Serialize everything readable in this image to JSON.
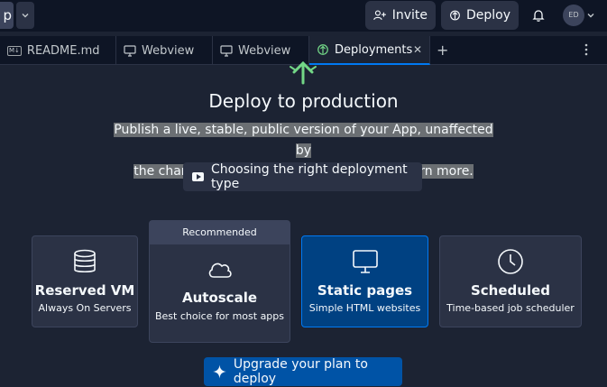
{
  "topbar": {
    "app_initial": "p",
    "invite_label": "Invite",
    "deploy_label": "Deploy",
    "avatar_initials": "ED"
  },
  "tabs": [
    {
      "label": "README.md",
      "icon": "markdown-icon",
      "badge": "M↓",
      "active": false
    },
    {
      "label": "Webview",
      "icon": "monitor-icon",
      "active": false
    },
    {
      "label": "Webview",
      "icon": "monitor-icon",
      "active": false
    },
    {
      "label": "Deployments",
      "icon": "deploy-icon",
      "active": true
    }
  ],
  "main": {
    "title": "Deploy to production",
    "description_line1": "Publish a live, stable, public version of your App, unaffected by",
    "description_line2": "the changes you make in the workspace. Learn more.",
    "guide_label": "Choosing the right deployment type",
    "upgrade_label": "Upgrade your plan to deploy"
  },
  "deployment_types": [
    {
      "name": "Reserved VM",
      "subtitle": "Always On Servers",
      "icon": "database-icon",
      "selected": false
    },
    {
      "name": "Autoscale",
      "subtitle": "Best choice for most apps",
      "icon": "cloud-icon",
      "badge": "Recommended",
      "selected": false
    },
    {
      "name": "Static pages",
      "subtitle": "Simple HTML websites",
      "icon": "monitor-icon",
      "selected": true
    },
    {
      "name": "Scheduled",
      "subtitle": "Time-based job scheduler",
      "icon": "clock-icon",
      "selected": false
    }
  ],
  "colors": {
    "background": "#1c2333",
    "topbar": "#0e1525",
    "card": "#2b3245",
    "selected_card": "#004182",
    "selected_border": "#0079f2",
    "primary_button": "#0053a6",
    "rocket_green": "#73d787"
  }
}
